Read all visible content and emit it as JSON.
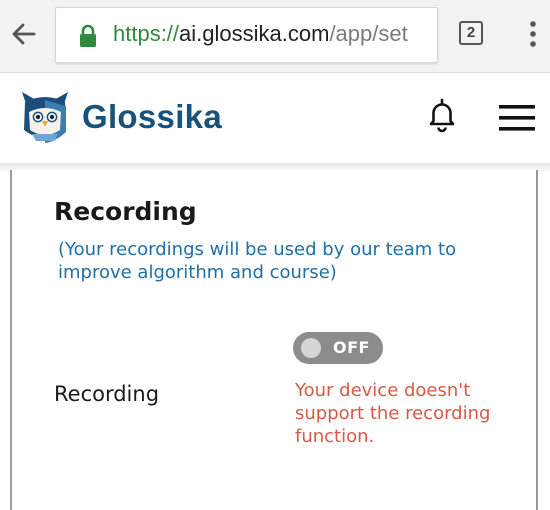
{
  "browser": {
    "url_scheme": "https://",
    "url_host": "ai.glossika.com",
    "url_path": "/app/set",
    "tab_count": "2"
  },
  "app": {
    "brand": "Glossika",
    "brand_color": "#17527a"
  },
  "settings": {
    "section_title": "Recording",
    "section_note": "(Your recordings will be used by our team to improve algorithm and course)",
    "recording": {
      "label": "Recording",
      "toggle_state": "OFF",
      "enabled": false,
      "error": "Your device doesn't support the recording function.",
      "error_color": "#d65a45"
    }
  },
  "icons": {
    "back": "back-arrow-icon",
    "lock": "lock-icon",
    "tabs": "tab-switcher-icon",
    "menu": "overflow-menu-icon",
    "logo": "owl-logo-icon",
    "bell": "bell-icon",
    "hamburger": "hamburger-menu-icon"
  }
}
